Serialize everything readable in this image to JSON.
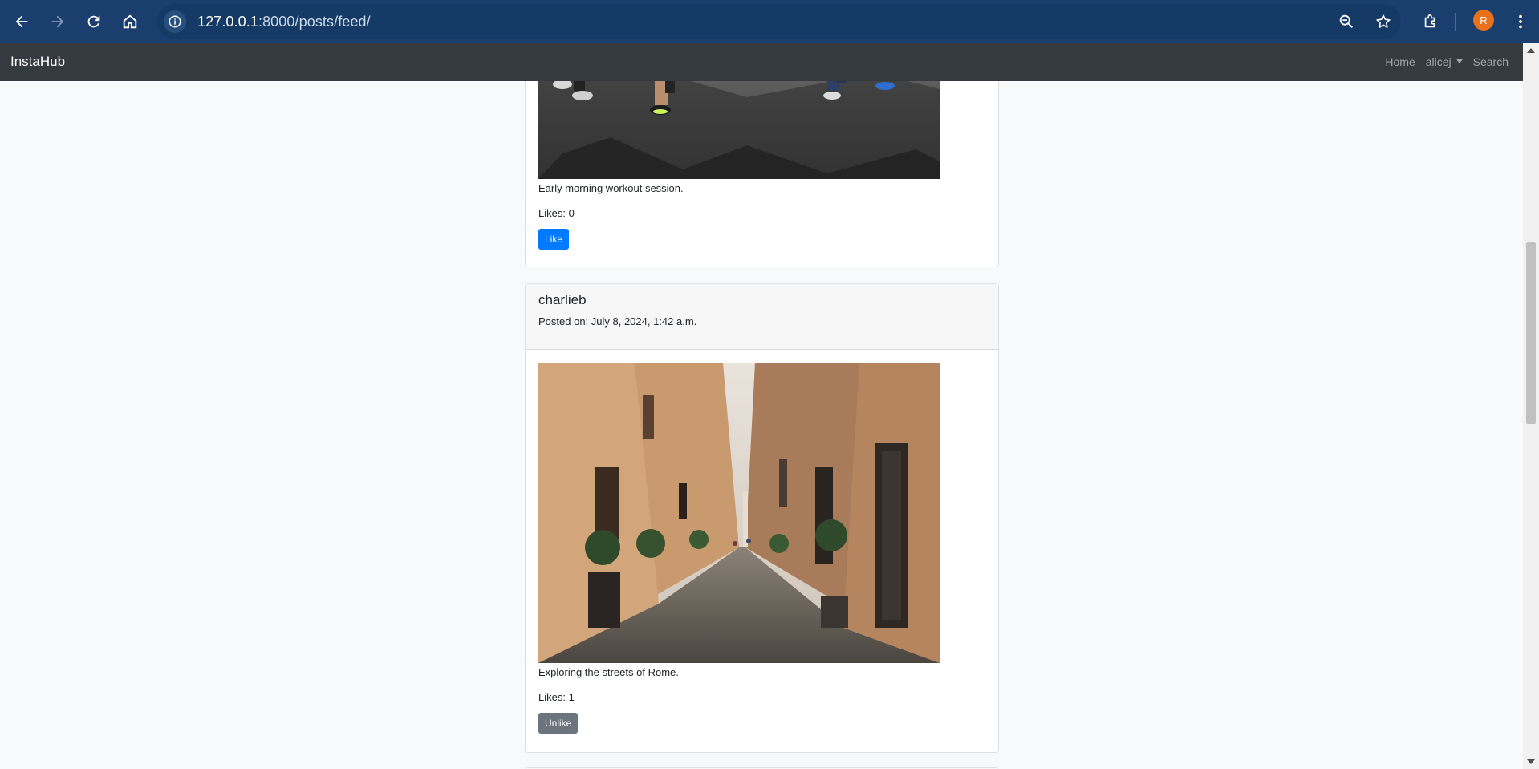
{
  "browser": {
    "url_host": "127.0.0.1",
    "url_rest": ":8000/posts/feed/",
    "profile_initial": "R"
  },
  "navbar": {
    "brand": "InstaHub",
    "home": "Home",
    "user": "alicej",
    "search": "Search"
  },
  "posts": [
    {
      "caption": "Early morning workout session.",
      "likes": "Likes: 0",
      "button": "Like"
    },
    {
      "username": "charlieb",
      "posted": "Posted on: July 8, 2024, 1:42 a.m.",
      "caption": "Exploring the streets of Rome.",
      "likes": "Likes: 1",
      "button": "Unlike"
    }
  ],
  "colors": {
    "chrome": "#1a3f6e",
    "navbar": "#343a40",
    "like_button": "#007bff",
    "unlike_button": "#6c757d"
  }
}
